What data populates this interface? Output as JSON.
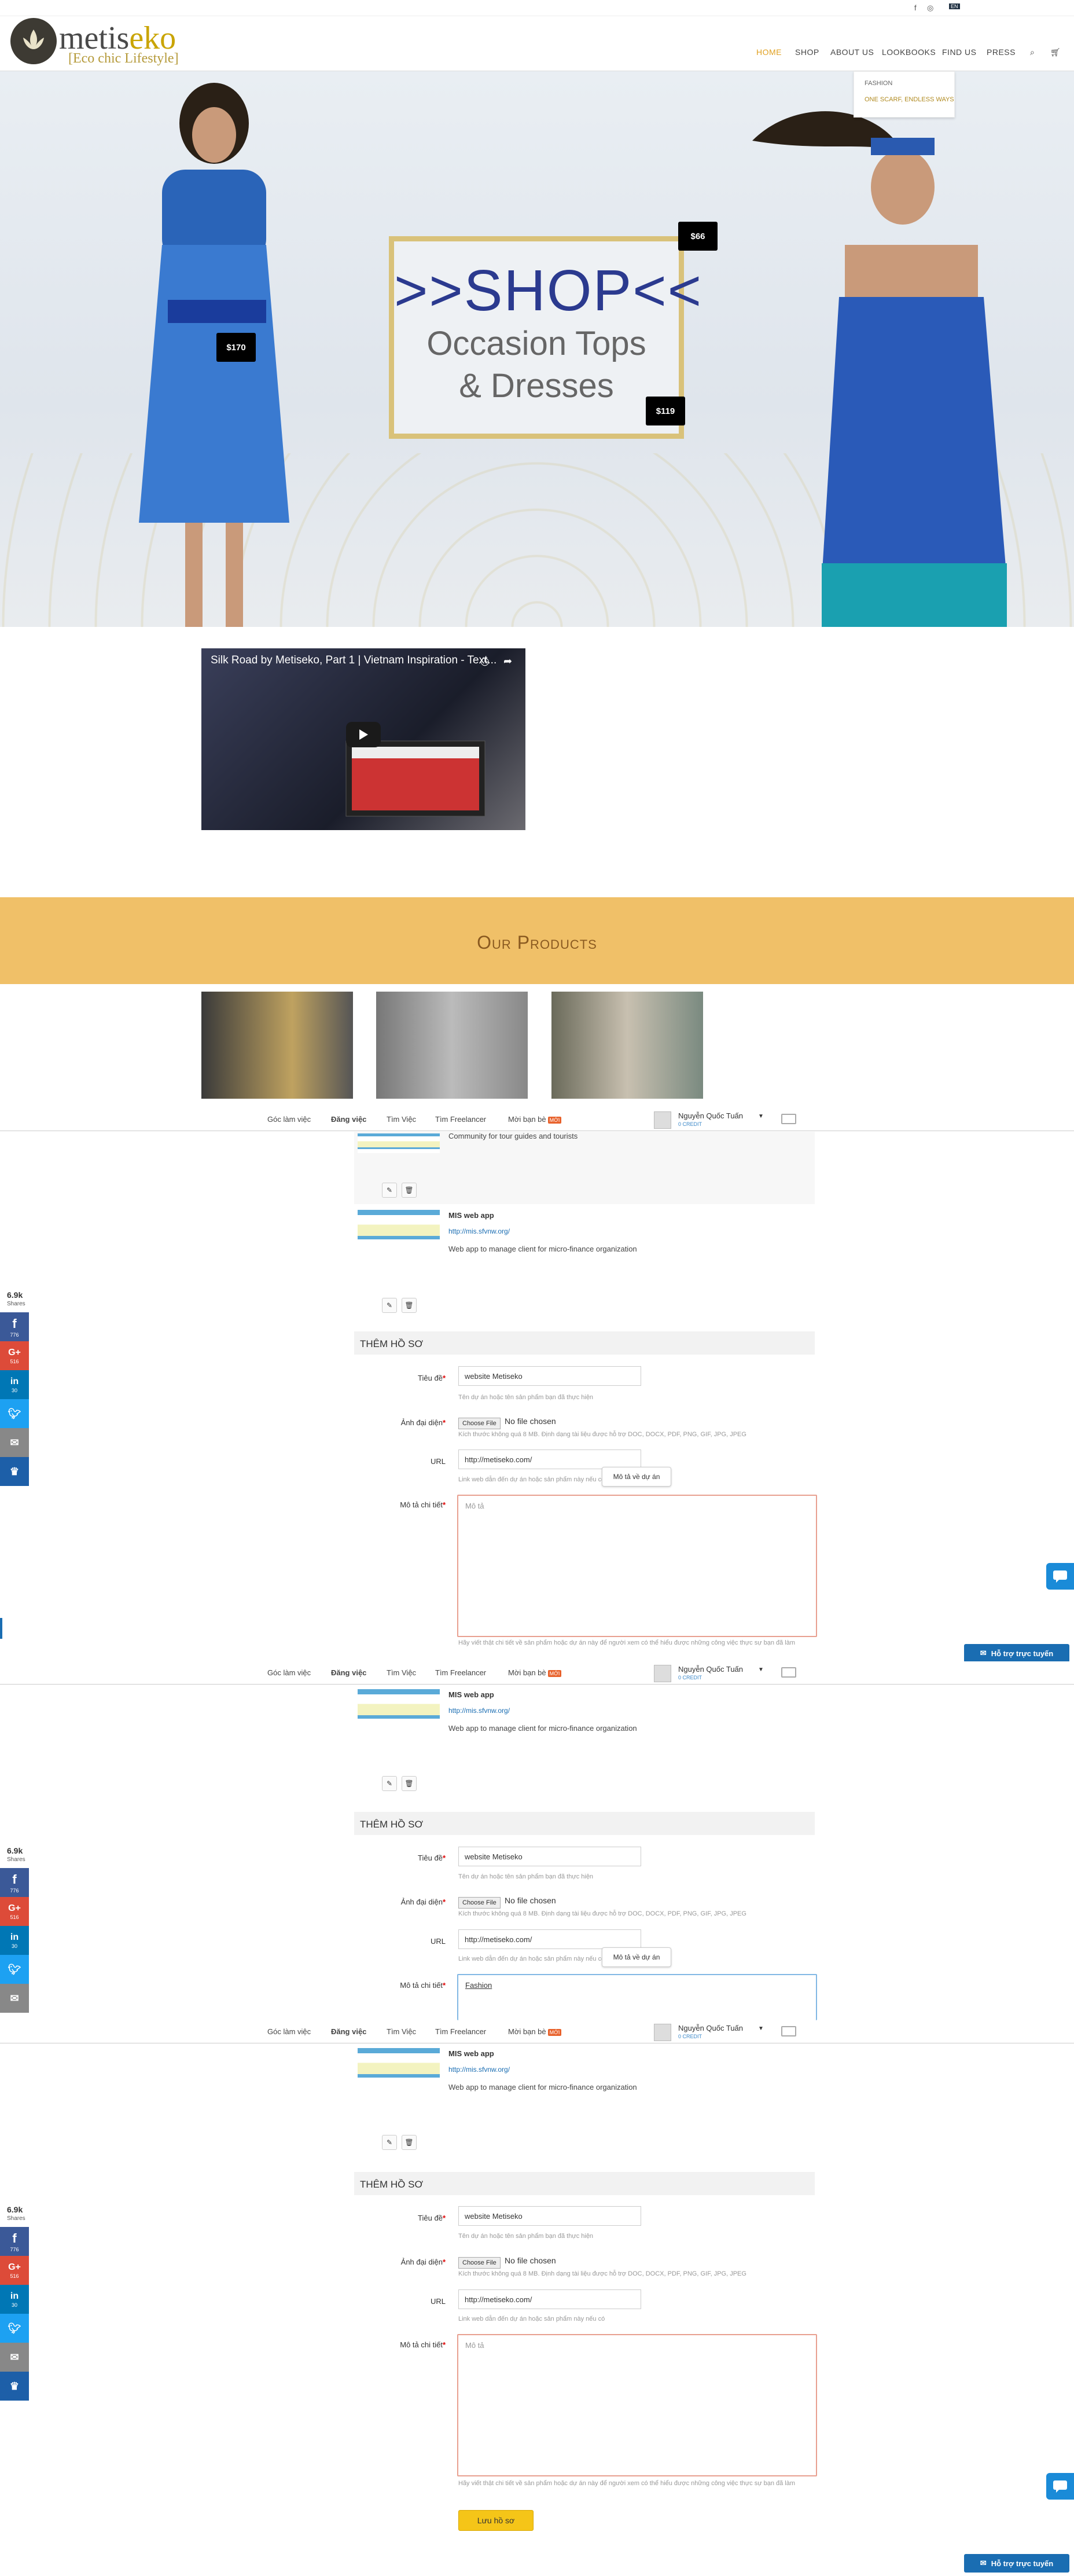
{
  "header": {
    "logo_main": "metis",
    "logo_accent": "eko",
    "logo_sub": "[Eco chic Lifestyle]",
    "social": [
      "f",
      "ig",
      "EN"
    ],
    "nav": [
      "HOME",
      "SHOP",
      "ABOUT US",
      "LOOKBOOKS",
      "FIND US",
      "PRESS"
    ],
    "dropdown": [
      "FASHION",
      "ONE SCARF, ENDLESS WAYS"
    ],
    "colors": {
      "accent": "#e0a020",
      "logo_gold": "#c9a400"
    }
  },
  "hero": {
    "line1": ">>SHOP<<",
    "line2": "Occasion Tops",
    "line3": "& Dresses",
    "prices": [
      "$170",
      "$66",
      "$119"
    ]
  },
  "video": {
    "title": "Silk Road by Metiseko, Part 1 | Vietnam Inspiration - Text..."
  },
  "products": {
    "title": "Our Products"
  },
  "job_header": {
    "nav": [
      "Góc làm việc",
      "Đăng việc",
      "Tìm Việc",
      "Tìm Freelancer",
      "Mời bạn bè"
    ],
    "new_badge": "MỚI",
    "user_name": "Nguyễn Quốc Tuấn",
    "user_credit": "0 CREDIT"
  },
  "projects": {
    "prev_desc": "Community for tour guides and tourists",
    "mis_title": "MIS web app",
    "mis_url": "http://mis.sfvnw.org/",
    "mis_desc": "Web app to manage client for micro-finance organization"
  },
  "form": {
    "section_title": "THÊM HỒ SƠ",
    "title_label": "Tiêu đề",
    "title_value": "website Metiseko",
    "title_hint": "Tên dự án hoặc tên sản phẩm bạn đã thực hiện",
    "image_label": "Ảnh đại diện",
    "choose_file": "Choose File",
    "no_file": "No file chosen",
    "image_hint": "Kích thước không quá 8 MB. Định dạng tài liệu được hỗ trợ DOC, DOCX, PDF, PNG, GIF, JPG, JPEG",
    "url_label": "URL",
    "url_value_1": "http://metiseko.com/",
    "url_value_2": "http://metiseko.com/",
    "url_hint": "Link web dẫn đến dự án hoặc sản phẩm này nếu có",
    "tooltip": "Mô tả về dự án",
    "desc_label": "Mô tả chi tiết",
    "desc_placeholder": "Mô tả",
    "desc_typed": "Fashion",
    "desc_hint": "Hãy viết thật chi tiết về sản phẩm hoặc dự án này để người xem có thể hiểu được những công việc thực sự bạn đã làm",
    "save": "Lưu hồ sơ"
  },
  "share": {
    "count": "6.9k",
    "shares": "Shares",
    "fb": "776",
    "gp": "516",
    "li": "30"
  },
  "support": {
    "label": "Hỗ trợ trực tuyến"
  }
}
